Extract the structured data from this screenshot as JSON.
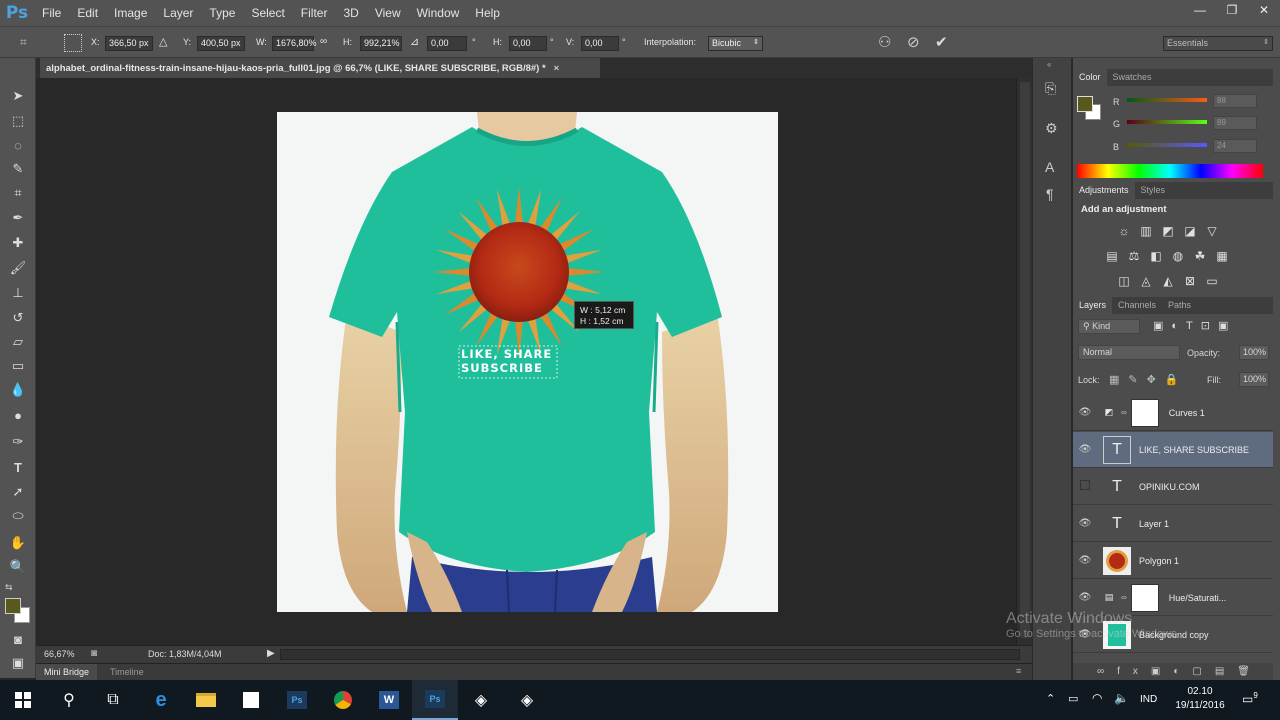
{
  "app": {
    "logo": "Ps",
    "menu": [
      "File",
      "Edit",
      "Image",
      "Layer",
      "Type",
      "Select",
      "Filter",
      "3D",
      "View",
      "Window",
      "Help"
    ],
    "window_controls": [
      "—",
      "❐",
      "✕"
    ]
  },
  "options_bar": {
    "x_label": "X:",
    "x_value": "366,50 px",
    "y_label": "Y:",
    "y_value": "400,50 px",
    "w_label": "W:",
    "w_value": "1676,80%",
    "h_label": "H:",
    "h_value": "992,21%",
    "rotate_value": "0,00",
    "deg": "°",
    "hskew_label": "H:",
    "hskew_value": "0,00",
    "vskew_label": "V:",
    "vskew_value": "0,00",
    "interpolation_label": "Interpolation:",
    "interpolation_value": "Bicubic",
    "workspace": "Essentials"
  },
  "document": {
    "tab_title": "alphabet_ordinal-fitness-train-insane-hijau-kaos-pria_full01.jpg @ 66,7% (LIKE, SHARE SUBSCRIBE, RGB/8#) *",
    "text_line1": "LIKE, SHARE",
    "text_line2": "SUBSCRIBE",
    "tooltip_w": "W :  5,12 cm",
    "tooltip_h": "H :  1,52 cm",
    "shirt_color": "#1fbf9c"
  },
  "status": {
    "zoom": "66,67%",
    "doc": "Doc: 1,83M/4,04M"
  },
  "bottom_tabs": [
    "Mini Bridge",
    "Timeline"
  ],
  "color_panel": {
    "tabs": [
      "Color",
      "Swatches"
    ],
    "r_label": "R",
    "r_value": "88",
    "g_label": "G",
    "g_value": "89",
    "b_label": "B",
    "b_value": "24",
    "foreground": "#58591a"
  },
  "adjustments_panel": {
    "tabs": [
      "Adjustments",
      "Styles"
    ],
    "heading": "Add an adjustment"
  },
  "layers_panel": {
    "tabs": [
      "Layers",
      "Channels",
      "Paths"
    ],
    "kind": "Kind",
    "blend_mode": "Normal",
    "opacity_label": "Opacity:",
    "opacity_value": "100%",
    "lock_label": "Lock:",
    "fill_label": "Fill:",
    "fill_value": "100%",
    "layers": [
      {
        "name": "Curves 1",
        "type": "adjustment",
        "visible": true,
        "selected": false
      },
      {
        "name": "LIKE, SHARE SUBSCRIBE",
        "type": "text",
        "visible": true,
        "selected": true
      },
      {
        "name": "OPINIKU.COM",
        "type": "text",
        "visible": false,
        "selected": false
      },
      {
        "name": "Layer 1",
        "type": "text",
        "visible": true,
        "selected": false
      },
      {
        "name": "Polygon 1",
        "type": "image",
        "visible": true,
        "selected": false
      },
      {
        "name": "Hue/Saturati...",
        "type": "adjustment",
        "visible": true,
        "selected": false
      },
      {
        "name": "Background copy",
        "type": "image",
        "visible": true,
        "selected": false
      }
    ]
  },
  "watermark": {
    "line1": "Activate Windows",
    "line2": "Go to Settings to activate Windows."
  },
  "taskbar": {
    "language": "IND",
    "time": "02.10",
    "date": "19/11/2016",
    "notifications": "9"
  }
}
